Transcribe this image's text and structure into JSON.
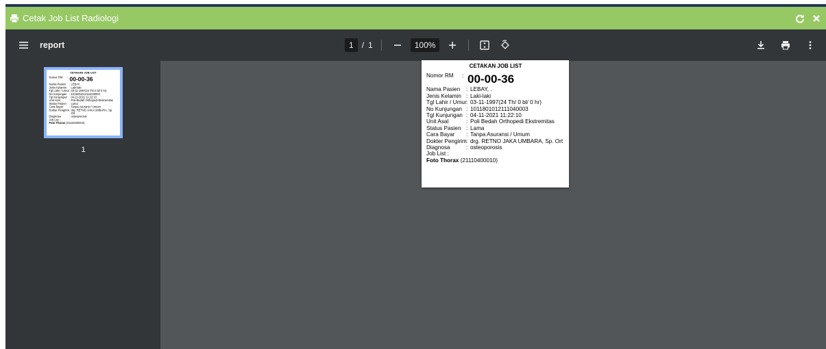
{
  "window": {
    "title": "Cetak Job List Radiologi"
  },
  "viewer": {
    "doc_name": "report",
    "page_current": "1",
    "page_sep": "/",
    "page_total": "1",
    "zoom": "100%",
    "thumb_page_number": "1"
  },
  "document": {
    "title": "CETAKAN JOB LIST",
    "nomor_rm_label": "Nomor RM",
    "nomor_rm_value": "00-00-36",
    "colon": ":",
    "fields": [
      {
        "label": "Nama Pasien",
        "value": "LEBAY, ."
      },
      {
        "label": "Jenis Kelamin",
        "value": "Laki-laki"
      },
      {
        "label": "Tgl Lahir / Umur",
        "value": "03-11-1997(24 Th/ 0 bl/ 0 hr)"
      },
      {
        "label": "No Kunjungan",
        "value": "1011801012111040003"
      },
      {
        "label": "Tgl Kunjungan",
        "value": "04-11-2021 11:22:10"
      },
      {
        "label": "Unit Asal",
        "value": "Poli Bedah Orthopedi Ekstremitas"
      },
      {
        "label": "Status Pasien",
        "value": "Lama"
      },
      {
        "label": "Cara Bayar",
        "value": "Tanpa Asuransi / Umum"
      },
      {
        "label": "Dokter Pengirim",
        "value": "drg. RETNO JAKA UMBARA, Sp. Ort"
      },
      {
        "label": "Diagnosa",
        "value": "osteoporosis"
      }
    ],
    "job_list_label": "Job List :",
    "job_item_name": "Foto Thorax",
    "job_item_code": "(21110400010)"
  },
  "colors": {
    "header_green": "#96c864",
    "viewer_bg": "#525659",
    "toolbar_bg": "#323639",
    "thumb_border": "#8ab4f8"
  },
  "icons": {
    "title": "print-icon",
    "refresh": "refresh-icon",
    "close": "close-icon",
    "menu": "menu-icon",
    "zoom_out": "minus-icon",
    "zoom_in": "plus-icon",
    "fit": "fit-page-icon",
    "rotate": "rotate-icon",
    "download": "download-icon",
    "print": "print-icon",
    "more": "more-vert-icon"
  }
}
